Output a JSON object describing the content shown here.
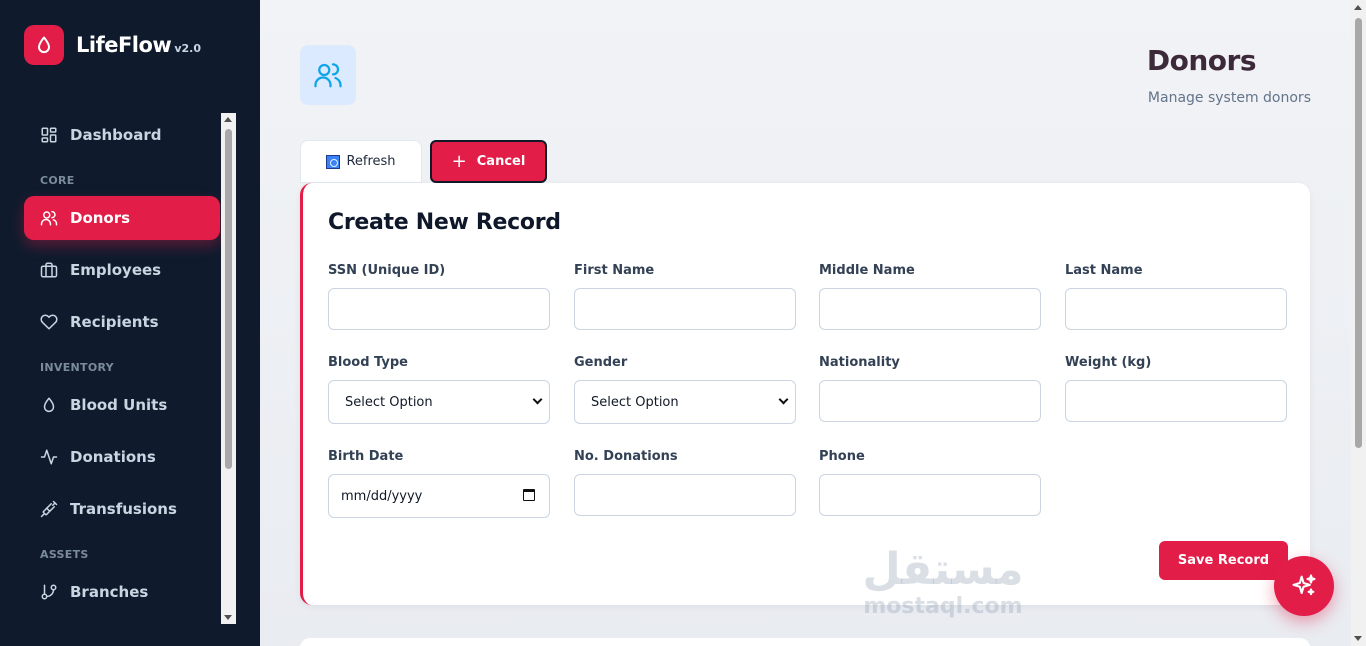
{
  "app": {
    "name": "LifeFlow",
    "version": "v2.0"
  },
  "sidebar": {
    "sections": {
      "core": "CORE",
      "inventory": "INVENTORY",
      "assets": "ASSETS"
    },
    "items": [
      {
        "label": "Dashboard",
        "icon": "dashboard-icon"
      },
      {
        "label": "Donors",
        "icon": "users-icon",
        "active": true
      },
      {
        "label": "Employees",
        "icon": "briefcase-icon"
      },
      {
        "label": "Recipients",
        "icon": "heart-icon"
      },
      {
        "label": "Blood Units",
        "icon": "droplet-icon"
      },
      {
        "label": "Donations",
        "icon": "activity-icon"
      },
      {
        "label": "Transfusions",
        "icon": "syringe-icon"
      },
      {
        "label": "Branches",
        "icon": "git-branch-icon"
      }
    ]
  },
  "header": {
    "title": "Donors",
    "subtitle": "Manage system donors"
  },
  "toolbar": {
    "refresh_label": "Refresh",
    "cancel_label": "Cancel"
  },
  "form": {
    "title": "Create New Record",
    "fields": {
      "ssn": {
        "label": "SSN (Unique ID)",
        "value": ""
      },
      "first_name": {
        "label": "First Name",
        "value": ""
      },
      "middle_name": {
        "label": "Middle Name",
        "value": ""
      },
      "last_name": {
        "label": "Last Name",
        "value": ""
      },
      "blood_type": {
        "label": "Blood Type",
        "value": "Select Option"
      },
      "gender": {
        "label": "Gender",
        "value": "Select Option"
      },
      "nationality": {
        "label": "Nationality",
        "value": ""
      },
      "weight": {
        "label": "Weight (kg)",
        "value": ""
      },
      "birth_date": {
        "label": "Birth Date",
        "value": "mm/dd/yyyy"
      },
      "donations": {
        "label": "No. Donations",
        "value": ""
      },
      "phone": {
        "label": "Phone",
        "value": ""
      }
    },
    "save_label": "Save Record"
  },
  "watermark": {
    "arabic": "مستقل",
    "latin": "mostaql.com"
  },
  "colors": {
    "accent": "#e11d48",
    "sidebar": "#0f1b2d"
  }
}
